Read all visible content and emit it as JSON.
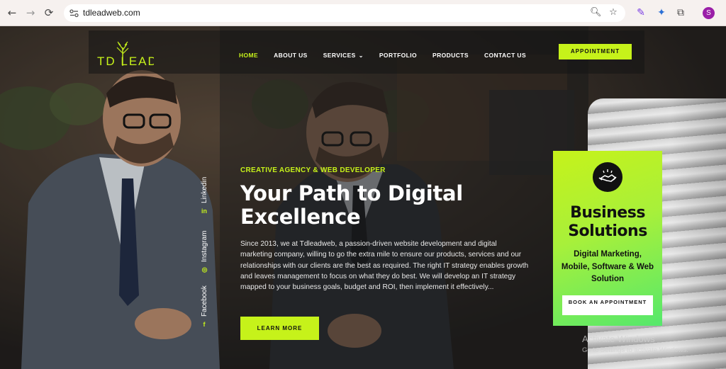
{
  "browser": {
    "back_icon": "arrow-left",
    "forward_icon": "arrow-right",
    "reload_icon": "reload",
    "url": "tdleadweb.com",
    "profile_initial": "S"
  },
  "header": {
    "logo_text": "TD LEAD",
    "menu": [
      {
        "label": "HOME",
        "active": true
      },
      {
        "label": "ABOUT US"
      },
      {
        "label": "SERVICES",
        "has_dropdown": true
      },
      {
        "label": "PORTFOLIO"
      },
      {
        "label": "PRODUCTS"
      },
      {
        "label": "CONTACT US"
      }
    ],
    "appointment_label": "APPOINTMENT"
  },
  "social": [
    {
      "label": "Linkedin",
      "icon": "in"
    },
    {
      "label": "Instagram",
      "icon": "instagram"
    },
    {
      "label": "Facebook",
      "icon": "f"
    }
  ],
  "hero": {
    "eyebrow": "CREATIVE AGENCY & WEB DEVELOPER",
    "title": "Your Path to Digital Excellence",
    "text": "Since 2013, we at Tdleadweb, a passion-driven website development and digital marketing company, willing to go the extra mile to ensure our products, services and our relationships with our clients are the best as required. The right IT strategy enables growth and leaves management to focus on what they do best. We will develop an IT strategy mapped to your business goals, budget and ROI, then implement it effectively...",
    "cta_label": "LEARN MORE"
  },
  "promo": {
    "title": "Business Solutions",
    "subtitle": "Digital Marketing, Mobile, Software & Web Solution",
    "button_label": "BOOK AN APPOINTMENT"
  },
  "watermark": {
    "line1": "Activate Windows",
    "line2": "Go to Settings to activate Windows."
  },
  "colors": {
    "accent": "#c6f21a",
    "promo_gradient_end": "#55e86c"
  }
}
